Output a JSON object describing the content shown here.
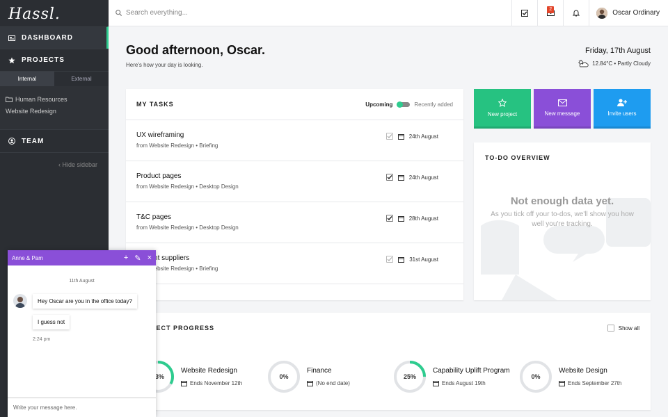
{
  "app": {
    "logo": "Hassl."
  },
  "sidebar": {
    "items": [
      {
        "label": "DASHBOARD",
        "icon": "dashboard-icon"
      },
      {
        "label": "PROJECTS",
        "icon": "star-icon"
      },
      {
        "label": "TEAM",
        "icon": "user-circle-icon"
      }
    ],
    "subtabs": [
      "Internal",
      "External"
    ],
    "projects": [
      {
        "label": "Human Resources",
        "icon": "folder-icon"
      },
      {
        "label": "Website Redesign"
      }
    ],
    "hide_label": "‹ Hide sidebar"
  },
  "topbar": {
    "search_placeholder": "Search everything...",
    "message_badge": "2",
    "user_name": "Oscar Ordinary"
  },
  "header": {
    "greeting": "Good afternoon, Oscar.",
    "subtitle": "Here's how your day is looking.",
    "date": "Friday, 17th August",
    "weather": "12.84°C • Partly Cloudy"
  },
  "tasks": {
    "title": "MY TASKS",
    "toggle_left": "Upcoming",
    "toggle_right": "Recently added",
    "items": [
      {
        "name": "UX wireframing",
        "meta": "from Website Redesign • Briefing",
        "date": "24th August",
        "checked": false
      },
      {
        "name": "Product pages",
        "meta": "from Website Redesign • Desktop Design",
        "date": "24th August",
        "checked": true
      },
      {
        "name": "T&C pages",
        "meta": "from Website Redesign • Desktop Design",
        "date": "28th August",
        "checked": true
      },
      {
        "name": "Current suppliers",
        "meta": "from Website Redesign • Briefing",
        "date": "31st August",
        "checked": false
      }
    ]
  },
  "actions": [
    {
      "label": "New project",
      "color": "#26c281",
      "icon": "star-icon"
    },
    {
      "label": "New message",
      "color": "#8a4fd8",
      "icon": "envelope-icon"
    },
    {
      "label": "Invite users",
      "color": "#1e9cf0",
      "icon": "user-plus-icon"
    }
  ],
  "todo": {
    "title": "TO-DO OVERVIEW",
    "empty_title": "Not enough data yet.",
    "empty_text": "As you tick off your to-dos, we'll show you how well you're tracking."
  },
  "progress": {
    "title": "PROJECT PROGRESS",
    "show_all": "Show all",
    "projects": [
      {
        "name": "Website Redesign",
        "percent": 33,
        "label": "33%",
        "date": "Ends November 12th"
      },
      {
        "name": "Finance",
        "percent": 0,
        "label": "0%",
        "date": "(No end date)"
      },
      {
        "name": "Capability Uplift Program",
        "percent": 25,
        "label": "25%",
        "date": "Ends August 19th"
      },
      {
        "name": "Website Design",
        "percent": 0,
        "label": "0%",
        "date": "Ends September 27th"
      }
    ]
  },
  "chat": {
    "title": "Anne & Pam",
    "date": "11th August",
    "messages": [
      "Hey Oscar are you in the office today?",
      "I guess not"
    ],
    "time": "2:24 pm",
    "input_placeholder": "Write your message here."
  },
  "colors": {
    "accent": "#2ecc8f",
    "purple": "#8a4fd8",
    "blue": "#1e9cf0",
    "green": "#26c281"
  }
}
